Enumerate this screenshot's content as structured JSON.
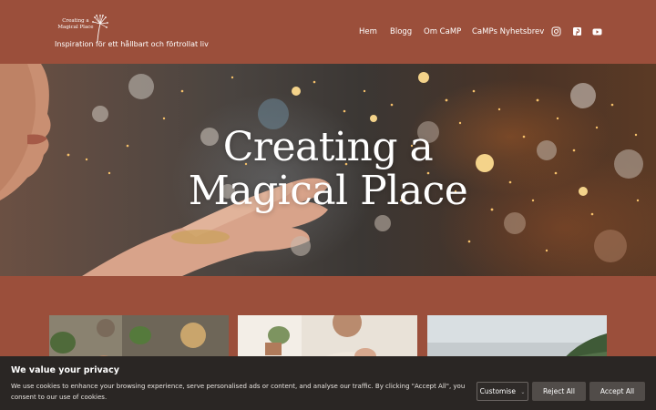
{
  "header": {
    "logo_text_line1": "Creating a",
    "logo_text_line2": "Magical Place",
    "tagline": "Inspiration för ett hållbart och förtrollat liv",
    "nav": [
      "Hem",
      "Blogg",
      "Om CaMP",
      "CaMPs Nyhetsbrev"
    ],
    "social": [
      "instagram-icon",
      "pinterest-icon",
      "youtube-icon"
    ]
  },
  "hero": {
    "title_line1": "Creating a",
    "title_line2": "Magical Place"
  },
  "cookie": {
    "title": "We value your privacy",
    "text": "We use cookies to enhance your browsing experience, serve personalised ads or content, and analyse our traffic. By clicking \"Accept All\", you consent to our use of cookies.",
    "customise_label": "Customise",
    "reject_label": "Reject All",
    "accept_label": "Accept All"
  },
  "colors": {
    "brand": "#9b4f3b",
    "banner": "#2a2624",
    "button": "#514c49"
  }
}
